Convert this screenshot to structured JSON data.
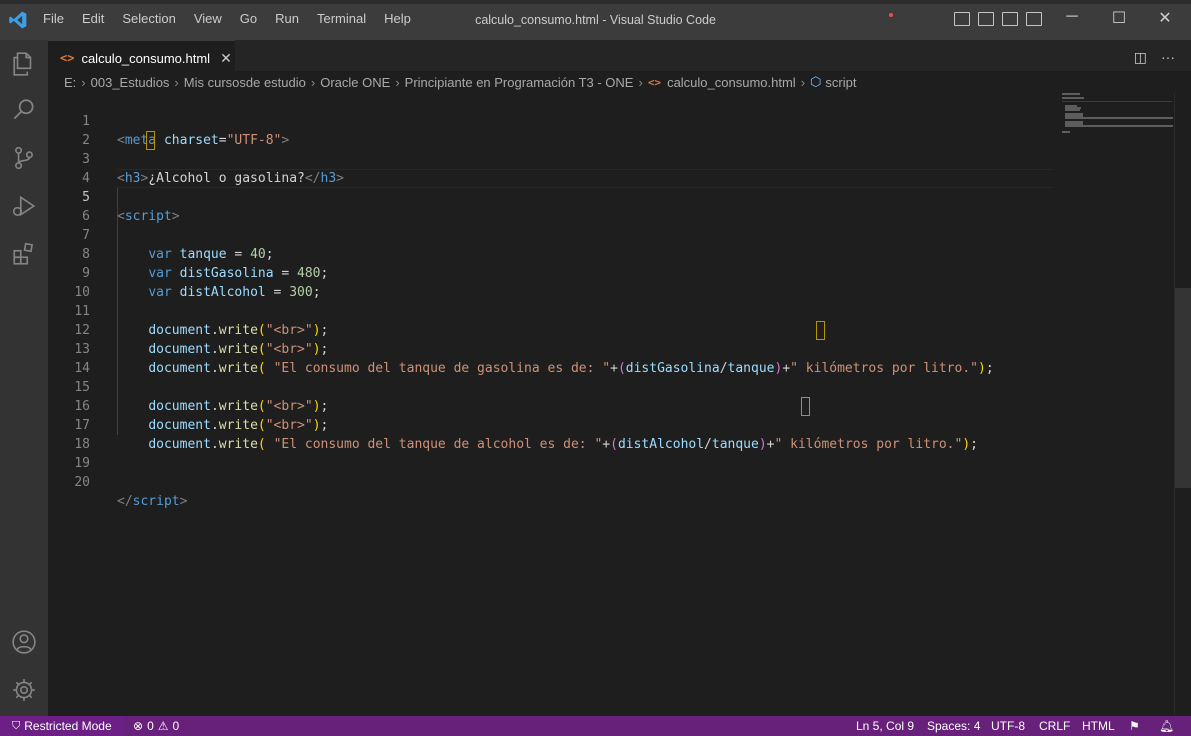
{
  "window": {
    "title": "calculo_consumo.html - Visual Studio Code",
    "menu": [
      "File",
      "Edit",
      "Selection",
      "View",
      "Go",
      "Run",
      "Terminal",
      "Help"
    ],
    "controls": {
      "minimize": "─",
      "maximize": "☐",
      "close": "✕"
    }
  },
  "activity_bar": {
    "items": [
      "explorer-icon",
      "search-icon",
      "source-control-icon",
      "run-debug-icon",
      "extensions-icon"
    ],
    "bottom": [
      "account-icon",
      "manage-gear-icon"
    ]
  },
  "tab": {
    "label": "calculo_consumo.html",
    "icon": "<>",
    "close": "✕"
  },
  "breadcrumb": {
    "items": [
      "E:",
      "003_Estudios",
      "Mis cursosde estudio",
      "Oracle ONE",
      "Principiante en Programación T3 - ONE"
    ],
    "file": "calculo_consumo.html",
    "symbol": "script"
  },
  "editor": {
    "language": "html",
    "active_line": 5,
    "lines": [
      {
        "n": "1"
      },
      {
        "n": "2"
      },
      {
        "n": "3"
      },
      {
        "n": "4"
      },
      {
        "n": "5"
      },
      {
        "n": "6"
      },
      {
        "n": "7"
      },
      {
        "n": "8"
      },
      {
        "n": "9"
      },
      {
        "n": "10"
      },
      {
        "n": "11"
      },
      {
        "n": "12"
      },
      {
        "n": "13"
      },
      {
        "n": "14"
      },
      {
        "n": "15"
      },
      {
        "n": "16"
      },
      {
        "n": "17"
      },
      {
        "n": "18"
      },
      {
        "n": "19"
      },
      {
        "n": "20"
      }
    ],
    "code": {
      "l1": {
        "open": "<",
        "tag": "meta",
        "attr": "charset",
        "eq": "=",
        "val": "\"UTF-8\"",
        "close": ">"
      },
      "l3": {
        "open": "<",
        "tag": "h3",
        "close": ">",
        "text": "¿Alcohol o gasolina?",
        "end_open": "</",
        "end_tag": "h3",
        "end_close": ">"
      },
      "l5": {
        "open": "<",
        "tag": "script",
        "close": ">"
      },
      "l7": {
        "kw": "var",
        "name": "tanque",
        "op": " = ",
        "num": "40",
        "semi": ";"
      },
      "l8": {
        "kw": "var",
        "name": "distGasolina",
        "op": " = ",
        "num": "480",
        "semi": ";"
      },
      "l9": {
        "kw": "var",
        "name": "distAlcohol",
        "op": " = ",
        "num": "300",
        "semi": ";"
      },
      "doc": "document",
      "dot": ".",
      "write": "write",
      "br_str": "\"<br>\"",
      "l13": {
        "str1": "\"El consumo del tanque de gasolina es de: \"",
        "plus": "+",
        "a": "distGasolina",
        "slash": "/",
        "b": "tanque",
        "str2": "\" kilómetros por litro.\""
      },
      "l17": {
        "str1": "\"El consumo del tanque de alcohol es de: \"",
        "plus": "+",
        "a": "distAlcohol",
        "slash": "/",
        "b": "tanque",
        "str2": "\" kilómetros por litro.\""
      },
      "l20": {
        "open": "</",
        "tag": "script",
        "close": ">"
      }
    }
  },
  "status_bar": {
    "restricted": "Restricted Mode",
    "errors": "0",
    "warnings": "0",
    "position": "Ln 5, Col 9",
    "spaces": "Spaces: 4",
    "encoding": "UTF-8",
    "eol": "CRLF",
    "language": "HTML"
  },
  "colors": {
    "status_bar": "#68217a",
    "accent_html": "#e37933",
    "tag": "#569cd6",
    "string": "#ce9178",
    "number": "#b5cea8"
  }
}
